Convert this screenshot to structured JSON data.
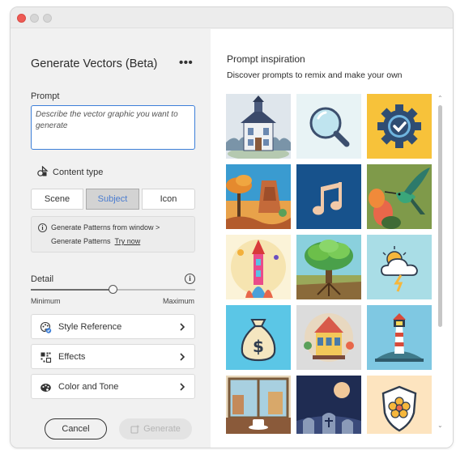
{
  "window": {
    "controls": [
      "close",
      "minimize",
      "zoom"
    ]
  },
  "panel": {
    "title": "Generate Vectors (Beta)",
    "more_icon": "more-icon",
    "prompt": {
      "label": "Prompt",
      "placeholder": "Describe the vector graphic you want to generate",
      "value": ""
    },
    "content_type": {
      "label": "Content type",
      "icon": "content-type-icon",
      "options": [
        "Scene",
        "Subject",
        "Icon"
      ],
      "selected": "Subject"
    },
    "info": {
      "line1": "Generate Patterns from window >",
      "line2": "Generate Patterns",
      "link": "Try now"
    },
    "detail": {
      "label": "Detail",
      "min_label": "Minimum",
      "max_label": "Maximum",
      "value": 0.5
    },
    "sections": [
      {
        "label": "Style Reference",
        "icon": "style-reference-icon"
      },
      {
        "label": "Effects",
        "icon": "effects-icon"
      },
      {
        "label": "Color and Tone",
        "icon": "color-and-tone-icon"
      }
    ],
    "buttons": {
      "cancel": "Cancel",
      "generate": "Generate"
    }
  },
  "inspiration": {
    "title": "Prompt inspiration",
    "subtitle": "Discover prompts to remix and make your own",
    "thumbnails": [
      {
        "name": "thumb-victorian-house",
        "bg": "#dfe6ec"
      },
      {
        "name": "thumb-magnifier",
        "bg": "#e8f3f5"
      },
      {
        "name": "thumb-gear-check",
        "bg": "#f7c23a"
      },
      {
        "name": "thumb-desert-canyon",
        "bg": "#3a9bd0"
      },
      {
        "name": "thumb-music-note",
        "bg": "#17528c"
      },
      {
        "name": "thumb-hummingbird",
        "bg": "#7f9a4a"
      },
      {
        "name": "thumb-rocket-tower",
        "bg": "#fbf3d8"
      },
      {
        "name": "thumb-tree",
        "bg": "#8ad0dd"
      },
      {
        "name": "thumb-weather-cloud",
        "bg": "#a9dde6"
      },
      {
        "name": "thumb-money-bag",
        "bg": "#5bc6e6"
      },
      {
        "name": "thumb-carousel",
        "bg": "#dcdcdc"
      },
      {
        "name": "thumb-lighthouse",
        "bg": "#7fc8e2"
      },
      {
        "name": "thumb-cafe-window",
        "bg": "#e9d9bd"
      },
      {
        "name": "thumb-graveyard",
        "bg": "#1f2c52"
      },
      {
        "name": "thumb-shield-flower",
        "bg": "#fde4bf"
      }
    ]
  },
  "colors": {
    "accent": "#3d7fd8",
    "panel_bg": "#f1f1f1",
    "close_button": "#ee5b55"
  }
}
